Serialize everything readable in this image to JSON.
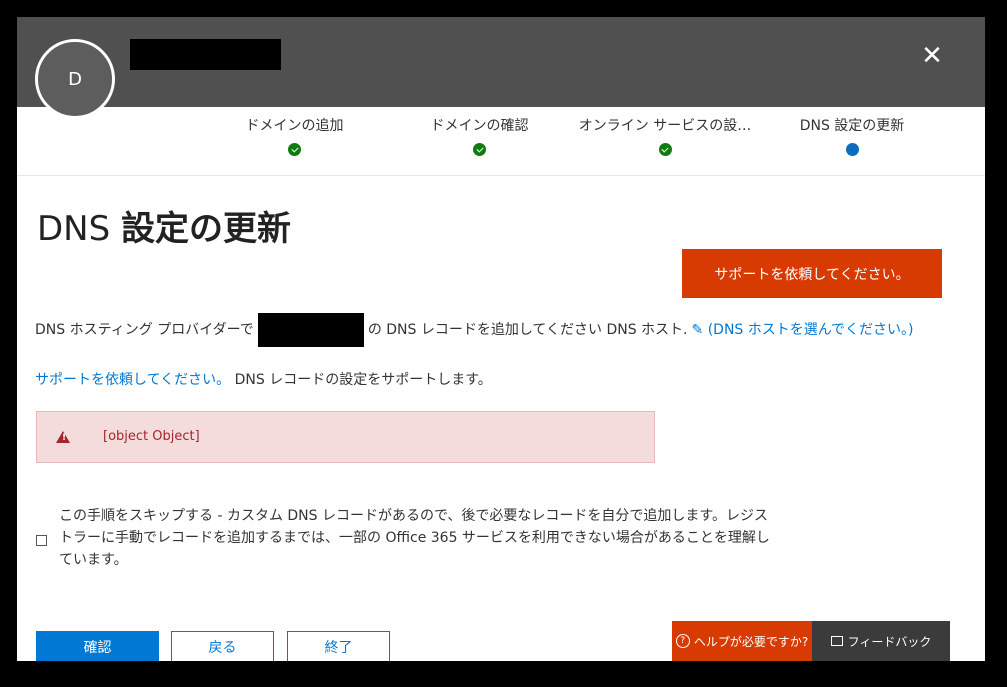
{
  "header": {
    "avatar_initial": "D",
    "close_glyph": "✕"
  },
  "steps": [
    {
      "label": "ドメインの追加",
      "status": "done"
    },
    {
      "label": "ドメインの確認",
      "status": "done"
    },
    {
      "label": "オンライン サービスの設…",
      "status": "done"
    },
    {
      "label": "DNS 設定の更新",
      "status": "current"
    }
  ],
  "page": {
    "title_prefix": "DNS",
    "title_main": "設定の更新",
    "support_button": "サポートを依頼してください。",
    "dns_text_before": "DNS ホスティング プロバイダーで",
    "dns_text_after": "の DNS レコードを追加してください DNS ホスト.",
    "dns_host_link": "(DNS ホストを選んでください。)",
    "support_link": "サポートを依頼してください。",
    "support_line_rest": " DNS レコードの設定をサポートします。",
    "error_text": "[object Object]",
    "skip_text": "この手順をスキップする - カスタム DNS レコードがあるので、後で必要なレコードを自分で追加します。レジストラーに手動でレコードを追加するまでは、一部の Office 365 サービスを利用できない場合があることを理解しています。"
  },
  "footer": {
    "confirm": "確認",
    "back": "戻る",
    "finish": "終了",
    "help": "ヘルプが必要ですか?",
    "help_icon": "?",
    "feedback": "フィードバック"
  },
  "colors": {
    "accent": "#0078d4",
    "support": "#d83b01",
    "header": "#505050",
    "done": "#107c10",
    "current": "#0f6cbd",
    "error_bg": "#f4dcdc",
    "error_text": "#a4262c"
  }
}
